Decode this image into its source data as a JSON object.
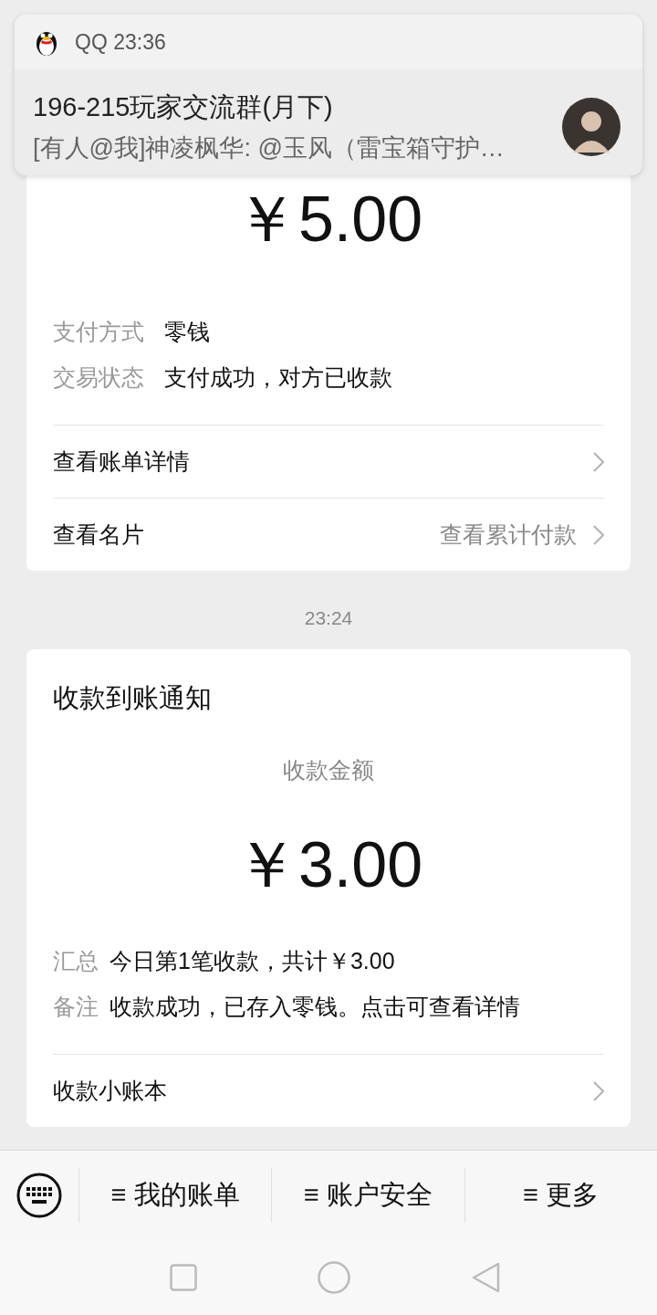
{
  "notification": {
    "app": "QQ 23:36",
    "title": "196-215玩家交流群(月下)",
    "message": "[有人@我]神凌枫华: @玉风（雷宝箱守护…"
  },
  "payment_card": {
    "amount": "￥5.00",
    "details": [
      {
        "label": "支付方式",
        "value": "零钱"
      },
      {
        "label": "交易状态",
        "value": "支付成功，对方已收款"
      }
    ],
    "links": [
      {
        "label": "查看账单详情"
      },
      {
        "label": "查看名片",
        "value": "查看累计付款"
      }
    ]
  },
  "timestamp": "23:24",
  "receipt_card": {
    "title": "收款到账通知",
    "amount_label": "收款金额",
    "amount": "￥3.00",
    "details": [
      {
        "label": "汇总",
        "value": "今日第1笔收款，共计￥3.00"
      },
      {
        "label": "备注",
        "value": "收款成功，已存入零钱。点击可查看详情"
      }
    ],
    "links": [
      {
        "label": "收款小账本"
      }
    ]
  },
  "menu": {
    "items": [
      "≡ 我的账单",
      "≡ 账户安全",
      "≡ 更多"
    ]
  }
}
